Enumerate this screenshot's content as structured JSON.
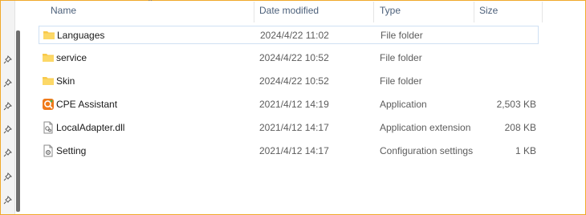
{
  "columns": {
    "name": "Name",
    "date_modified": "Date modified",
    "type": "Type",
    "size": "Size"
  },
  "files": [
    {
      "name": "Languages",
      "date": "2024/4/22 11:02",
      "type": "File folder",
      "size": "",
      "icon": "folder-icon"
    },
    {
      "name": "service",
      "date": "2024/4/22 10:52",
      "type": "File folder",
      "size": "",
      "icon": "folder-icon"
    },
    {
      "name": "Skin",
      "date": "2024/4/22 10:52",
      "type": "File folder",
      "size": "",
      "icon": "folder-icon"
    },
    {
      "name": "CPE Assistant",
      "date": "2021/4/12 14:19",
      "type": "Application",
      "size": "2,503 KB",
      "icon": "app-icon"
    },
    {
      "name": "LocalAdapter.dll",
      "date": "2021/4/12 14:17",
      "type": "Application extension",
      "size": "208 KB",
      "icon": "dll-file-icon"
    },
    {
      "name": "Setting",
      "date": "2021/4/12 14:17",
      "type": "Configuration settings",
      "size": "1 KB",
      "icon": "settings-file-icon"
    }
  ],
  "colors": {
    "folder": "#f8c94a",
    "accent_border": "#f0a92b",
    "selection_border": "#cfe0f3",
    "header_text": "#4c607a"
  }
}
